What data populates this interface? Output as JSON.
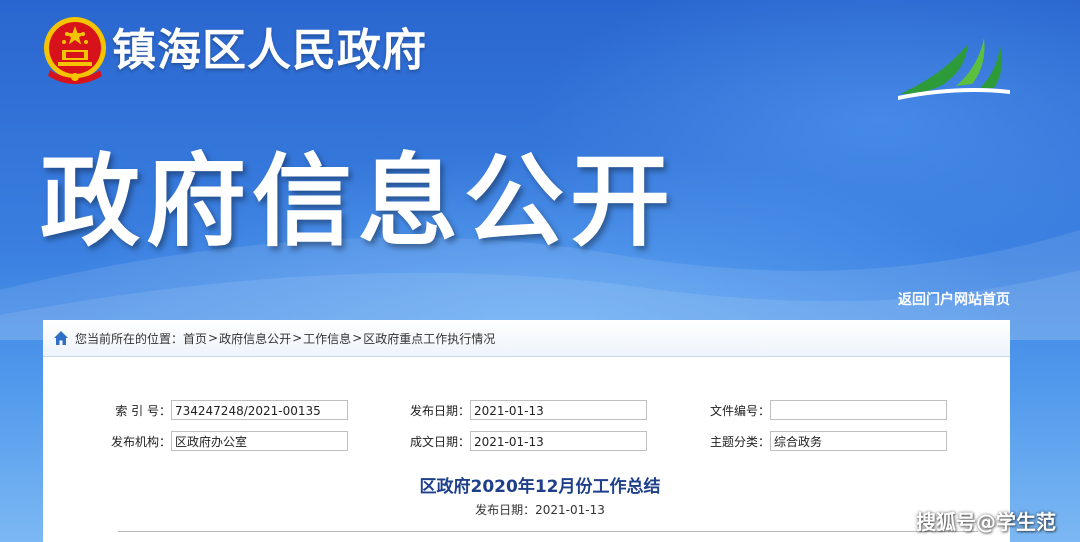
{
  "header": {
    "site_name": "镇海区人民政府",
    "section_title": "政府信息公开",
    "back_link": "返回门户网站首页"
  },
  "breadcrumb": {
    "prefix": "您当前所在的位置：",
    "items": [
      "首页",
      "政府信息公开",
      "工作信息",
      "区政府重点工作执行情况"
    ],
    "separator": ">"
  },
  "meta": {
    "index_label": "索 引 号：",
    "index_value": "734247248/2021-00135",
    "publish_date_label": "发布日期：",
    "publish_date_value": "2021-01-13",
    "doc_number_label": "文件编号：",
    "doc_number_value": "",
    "publisher_label": "发布机构：",
    "publisher_value": "区政府办公室",
    "created_date_label": "成文日期：",
    "created_date_value": "2021-01-13",
    "topic_label": "主题分类：",
    "topic_value": "综合政务"
  },
  "document": {
    "title": "区政府2020年12月份工作总结",
    "date_line": "发布日期：2021-01-13"
  },
  "watermark": "搜狐号@学生范",
  "colors": {
    "banner_blue": "#2f72d6",
    "title_blue": "#1e3f8a",
    "emblem_red": "#d8121b",
    "emblem_gold": "#f5c400",
    "logo_green": "#2e9b3a"
  },
  "icons": {
    "home": "home-icon",
    "emblem": "national-emblem-icon",
    "logo": "district-logo-icon"
  }
}
